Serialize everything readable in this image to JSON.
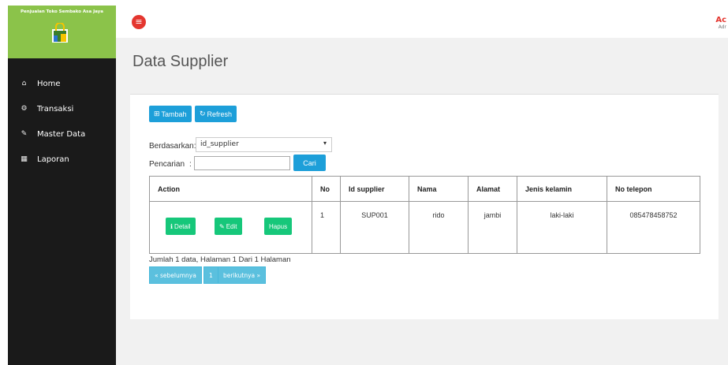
{
  "sidebar": {
    "brand_title": "Penjualan Toko Sembako Asa Jaya",
    "items": [
      {
        "label": "Home"
      },
      {
        "label": "Transaksi"
      },
      {
        "label": "Master Data"
      },
      {
        "label": "Laporan"
      }
    ]
  },
  "topbar": {
    "menu_icon": "≡",
    "user_name": "Ac",
    "user_role": "Adr"
  },
  "page": {
    "title": "Data Supplier"
  },
  "toolbar": {
    "tambah_label": "Tambah",
    "refresh_label": "Refresh"
  },
  "filter": {
    "berdasarkan_label": "Berdasarkan:",
    "selected": "id_supplier",
    "pencarian_label": "Pencarian",
    "pencarian_colon": ":",
    "cari_label": "Cari"
  },
  "table": {
    "headers": [
      "Action",
      "No",
      "Id supplier",
      "Nama",
      "Alamat",
      "Jenis kelamin",
      "No telepon"
    ],
    "rows": [
      {
        "no": "1",
        "id_supplier": "SUP001",
        "nama": "rido",
        "alamat": "jambi",
        "jenis_kelamin": "laki-laki",
        "no_telepon": "085478458752",
        "actions": {
          "detail": "Detail",
          "edit": "Edit",
          "hapus": "Hapus"
        }
      }
    ]
  },
  "pagination": {
    "summary": "Jumlah 1 data, Halaman 1 Dari 1 Halaman",
    "prev": "« sebelumnya",
    "page": "1",
    "next": "berikutnya »"
  },
  "colors": {
    "brand": "#8bc34a",
    "sidebar": "#1a1a1a",
    "primary": "#1d9fd9",
    "success": "#16c77a",
    "danger": "#e4362f",
    "info": "#5bc0de"
  }
}
